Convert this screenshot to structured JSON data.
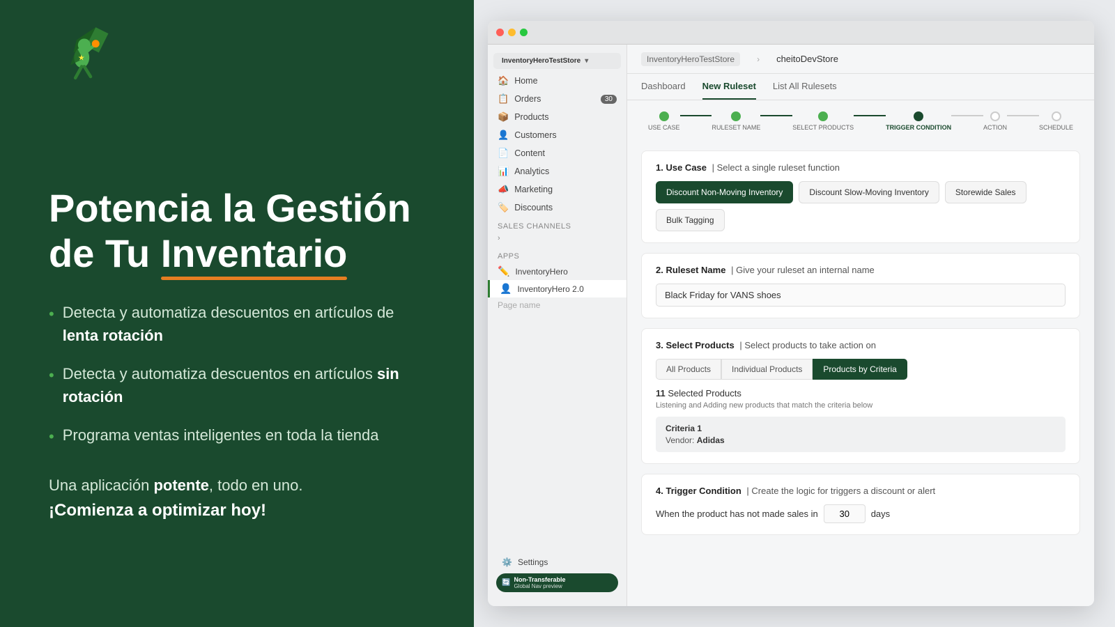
{
  "left": {
    "title_line1": "Potencia la Gestión",
    "title_line2": "de Tu",
    "title_underline": "Inventario",
    "bullets": [
      {
        "text_normal": "Detecta y automatiza descuentos en artículos de ",
        "text_bold": "lenta rotación"
      },
      {
        "text_normal": "Detecta y automatiza descuentos en artículos  ",
        "text_bold": "sin rotación"
      },
      {
        "text_normal": "Programa ventas inteligentes en toda la tienda",
        "text_bold": ""
      }
    ],
    "cta_normal": "Una aplicación potente, todo en uno.",
    "cta_highlight": "potente",
    "cta_strong": "¡Comienza a optimizar hoy!"
  },
  "shopify": {
    "store_name": "InventoryHeroTestStore",
    "breadcrumb_app": "cheitoDevStore",
    "tabs": [
      {
        "label": "Dashboard",
        "active": false
      },
      {
        "label": "New Ruleset",
        "active": true
      },
      {
        "label": "List All Rulesets",
        "active": false
      }
    ],
    "steps": [
      {
        "label": "USE CASE",
        "state": "done"
      },
      {
        "label": "RULESET NAME",
        "state": "done"
      },
      {
        "label": "SELECT PRODUCTS",
        "state": "done"
      },
      {
        "label": "TRIGGER CONDITION",
        "state": "active"
      },
      {
        "label": "ACTION",
        "state": "inactive"
      },
      {
        "label": "SCHEDULE",
        "state": "inactive"
      }
    ],
    "nav_items": [
      {
        "icon": "🏠",
        "label": "Home",
        "badge": null
      },
      {
        "icon": "📋",
        "label": "Orders",
        "badge": "30"
      },
      {
        "icon": "📦",
        "label": "Products",
        "badge": null
      },
      {
        "icon": "👤",
        "label": "Customers",
        "badge": null
      },
      {
        "icon": "📄",
        "label": "Content",
        "badge": null
      },
      {
        "icon": "📊",
        "label": "Analytics",
        "badge": null
      },
      {
        "icon": "📣",
        "label": "Marketing",
        "badge": null
      },
      {
        "icon": "🏷️",
        "label": "Discounts",
        "badge": null
      }
    ],
    "apps": [
      {
        "label": "InventoryHero",
        "active": false
      },
      {
        "label": "InventoryHero 2.0",
        "active": true
      },
      {
        "label": "Page name",
        "active": false
      }
    ],
    "section1": {
      "number": "1.",
      "title": "Use Case",
      "subtitle": "Select a single ruleset function",
      "buttons": [
        {
          "label": "Discount Non-Moving Inventory",
          "active": true
        },
        {
          "label": "Discount Slow-Moving Inventory",
          "active": false
        },
        {
          "label": "Storewide Sales",
          "active": false
        },
        {
          "label": "Bulk Tagging",
          "active": false
        }
      ]
    },
    "section2": {
      "number": "2.",
      "title": "Ruleset Name",
      "subtitle": "Give your ruleset an internal name",
      "value": "Black Friday for VANS shoes"
    },
    "section3": {
      "number": "3.",
      "title": "Select Products",
      "subtitle": "Select products to take action on",
      "tabs": [
        {
          "label": "All Products",
          "active": false
        },
        {
          "label": "Individual Products",
          "active": false
        },
        {
          "label": "Products by Criteria",
          "active": true
        }
      ],
      "selected_count": "11",
      "selected_label": "Selected Products",
      "selected_sub": "Listening and Adding new products that match the criteria below",
      "criteria_title": "Criteria 1",
      "criteria_detail_label": "Vendor: ",
      "criteria_detail_value": "Adidas"
    },
    "section4": {
      "number": "4.",
      "title": "Trigger Condition",
      "subtitle": "Create the logic for triggers a discount or alert",
      "trigger_text_before": "When the product has not made sales in",
      "trigger_value": "30",
      "trigger_text_after": "days"
    }
  }
}
